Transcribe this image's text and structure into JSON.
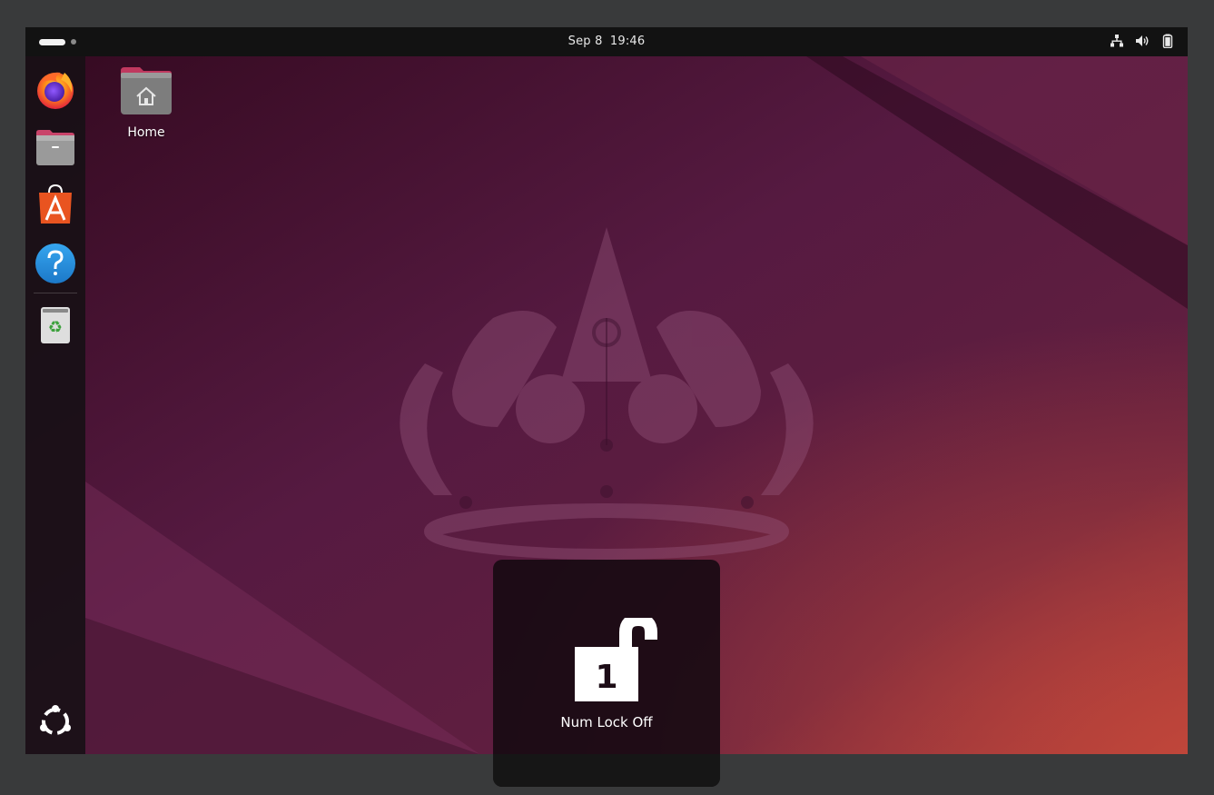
{
  "topbar": {
    "date": "Sep 8",
    "time": "19:46",
    "tray_icons": [
      "network-wired-icon",
      "volume-icon",
      "battery-icon"
    ]
  },
  "dock": {
    "items": [
      {
        "name": "firefox-icon"
      },
      {
        "name": "files-icon"
      },
      {
        "name": "app-center-icon"
      },
      {
        "name": "help-icon"
      },
      {
        "name": "trash-icon"
      }
    ],
    "show_apps_icon": "ubuntu-logo-icon"
  },
  "desktop": {
    "icons": [
      {
        "label": "Home",
        "icon": "home-folder-icon"
      }
    ]
  },
  "osd": {
    "label": "Num Lock Off",
    "icon": "unlocked-padlock-icon",
    "icon_glyph": "1"
  },
  "colors": {
    "wallpaper_base": "#3b0f2c",
    "wallpaper_highlight": "#c24a3a",
    "topbar": "#121212",
    "osd_background": "#160a12",
    "ubuntu_orange": "#e95420"
  }
}
